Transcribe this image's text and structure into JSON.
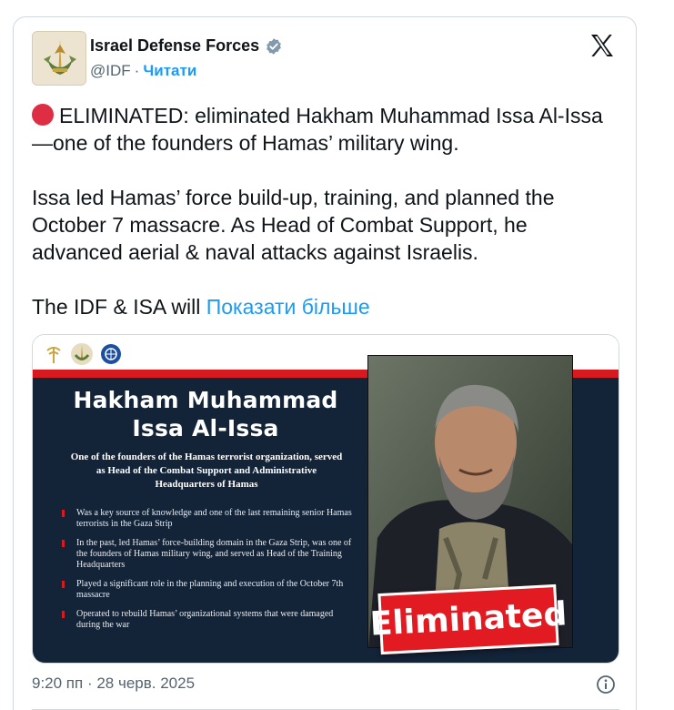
{
  "author": {
    "name": "Israel Defense Forces",
    "handle": "@IDF",
    "separator": "·",
    "follow_label": "Читати",
    "verified_icon": "verified-badge-icon",
    "avatar_icon": "idf-emblem-icon"
  },
  "platform_icon": "x-logo-icon",
  "post": {
    "para1": "ELIMINATED: eliminated Hakham Muhammad Issa Al-Issa—one of the founders of Hamas’ military wing.",
    "para2": "Issa led Hamas’ force build-up, training, and planned the October 7 massacre. As Head of Combat Support, he advanced aerial & naval attacks against Israelis.",
    "para3_prefix": "The IDF & ISA will ",
    "show_more": "Показати більше"
  },
  "image": {
    "title_line1": "Hakham Muhammad",
    "title_line2": "Issa Al-Issa",
    "subtitle": "One of the founders of the Hamas terrorist organization, served as Head of the Combat Support and Administrative Headquarters of Hamas",
    "bullets": [
      "Was a key source of knowledge and one of the last remaining senior Hamas terrorists in the Gaza Strip",
      "In the past, led Hamas’ force-building domain in the Gaza Strip, was one of the founders of Hamas military wing, and served as Head of the Training Headquarters",
      "Played a significant role in the planning and execution of the October 7th massacre",
      "Operated to rebuild Hamas’ organizational systems that were damaged during the war"
    ],
    "stamp": "Eliminated"
  },
  "footer": {
    "timestamp": "9:20 пп · 28 черв. 2025",
    "info_icon": "info-icon"
  },
  "colors": {
    "link": "#1d9bf0",
    "muted": "#536471",
    "stamp_red": "#e21a22",
    "navy": "#132338",
    "dot_red": "#dd2e44"
  }
}
